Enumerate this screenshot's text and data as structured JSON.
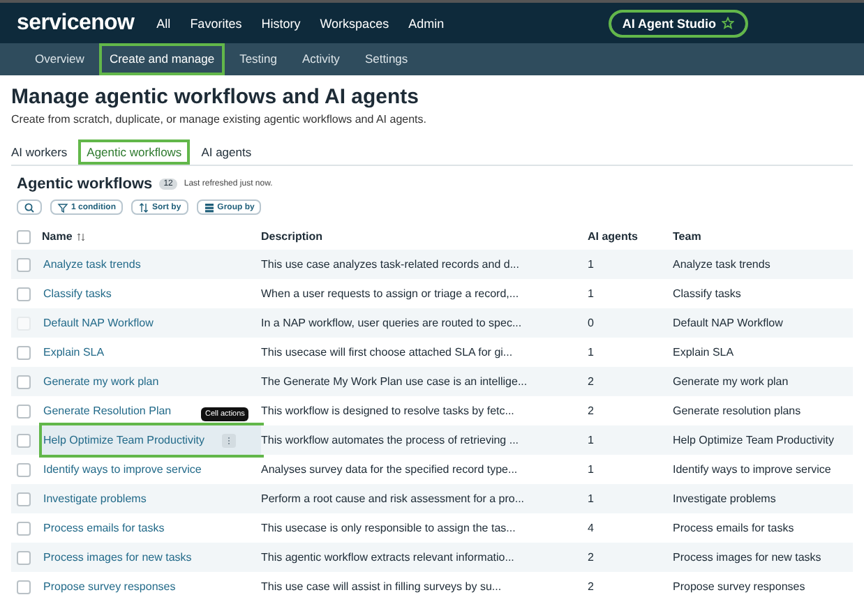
{
  "header": {
    "logo": "servicenow",
    "nav": [
      "All",
      "Favorites",
      "History",
      "Workspaces",
      "Admin"
    ],
    "app_pill": {
      "label": "AI Agent Studio",
      "highlighted": true
    }
  },
  "subnav": [
    {
      "label": "Overview",
      "selected": false,
      "highlighted": false
    },
    {
      "label": "Create and manage",
      "selected": true,
      "highlighted": true
    },
    {
      "label": "Testing",
      "selected": false,
      "highlighted": false
    },
    {
      "label": "Activity",
      "selected": false,
      "highlighted": false
    },
    {
      "label": "Settings",
      "selected": false,
      "highlighted": false
    }
  ],
  "page": {
    "title": "Manage agentic workflows and AI agents",
    "subtitle": "Create from scratch, duplicate, or manage existing agentic workflows and AI agents."
  },
  "tabs": [
    {
      "label": "AI workers",
      "selected": false,
      "highlighted": false
    },
    {
      "label": "Agentic workflows",
      "selected": true,
      "highlighted": true
    },
    {
      "label": "AI agents",
      "selected": false,
      "highlighted": false
    }
  ],
  "list": {
    "title": "Agentic workflows",
    "count": "12",
    "refreshed": "Last refreshed just now.",
    "toolbar": [
      {
        "kind": "search"
      },
      {
        "kind": "filter",
        "label": "1 condition"
      },
      {
        "kind": "sort",
        "label": "Sort by"
      },
      {
        "kind": "group",
        "label": "Group by"
      }
    ],
    "select_all": {
      "checked": false
    },
    "columns": [
      "Name",
      "Description",
      "AI agents",
      "Team"
    ],
    "rows": [
      {
        "name": "Analyze task trends",
        "description": "This use case analyzes task-related records and d...",
        "agents": "1",
        "team": "Analyze task trends",
        "disabled": false,
        "hovered": false,
        "highlighted": false
      },
      {
        "name": "Classify tasks",
        "description": "When a user requests to assign or triage a record,...",
        "agents": "1",
        "team": "Classify tasks",
        "disabled": false,
        "hovered": false,
        "highlighted": false
      },
      {
        "name": "Default NAP Workflow",
        "description": "In a NAP workflow, user queries are routed to spec...",
        "agents": "0",
        "team": "Default NAP Workflow",
        "disabled": true,
        "hovered": false,
        "highlighted": false
      },
      {
        "name": "Explain SLA",
        "description": "This usecase will first choose attached SLA for gi...",
        "agents": "1",
        "team": "Explain SLA",
        "disabled": false,
        "hovered": false,
        "highlighted": false
      },
      {
        "name": "Generate my work plan",
        "description": "The Generate My Work Plan use case is an intellige...",
        "agents": "2",
        "team": "Generate my work plan",
        "disabled": false,
        "hovered": false,
        "highlighted": false
      },
      {
        "name": "Generate Resolution Plan",
        "description": "This workflow is designed to resolve tasks by fetc...",
        "agents": "2",
        "team": "Generate resolution plans",
        "disabled": false,
        "hovered": false,
        "highlighted": false
      },
      {
        "name": "Help Optimize Team Productivity",
        "description": "This workflow automates the process of retrieving ...",
        "agents": "1",
        "team": "Help Optimize Team Productivity",
        "disabled": false,
        "hovered": true,
        "highlighted": true,
        "tooltip": "Cell actions"
      },
      {
        "name": "Identify ways to improve service",
        "description": "Analyses survey data for the specified record type...",
        "agents": "1",
        "team": "Identify ways to improve service",
        "disabled": false,
        "hovered": false,
        "highlighted": false
      },
      {
        "name": "Investigate problems",
        "description": "Perform a root cause and risk assessment for a pro...",
        "agents": "1",
        "team": "Investigate problems",
        "disabled": false,
        "hovered": false,
        "highlighted": false
      },
      {
        "name": "Process emails for tasks",
        "description": "This usecase is only responsible to assign the tas...",
        "agents": "4",
        "team": "Process emails for tasks",
        "disabled": false,
        "hovered": false,
        "highlighted": false
      },
      {
        "name": "Process images for new tasks",
        "description": "This agentic workflow extracts relevant informatio...",
        "agents": "2",
        "team": "Process images for new tasks",
        "disabled": false,
        "hovered": false,
        "highlighted": false
      },
      {
        "name": "Propose survey responses",
        "description": "This use case will assist in filling surveys by su...",
        "agents": "2",
        "team": "Propose survey responses",
        "disabled": false,
        "hovered": false,
        "highlighted": false
      }
    ]
  }
}
